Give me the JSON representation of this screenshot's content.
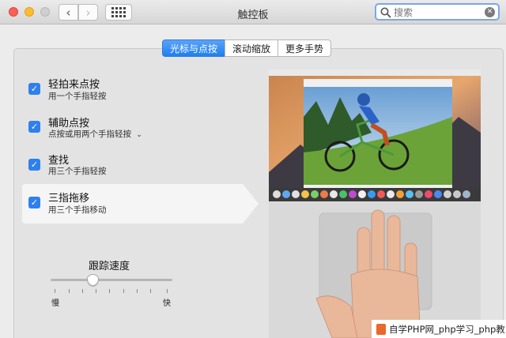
{
  "window": {
    "title": "触控板"
  },
  "search": {
    "placeholder": "搜索",
    "value": ""
  },
  "tabs": [
    {
      "label": "光标与点按",
      "active": true
    },
    {
      "label": "滚动缩放",
      "active": false
    },
    {
      "label": "更多手势",
      "active": false
    }
  ],
  "options": [
    {
      "title": "轻拍来点按",
      "subtitle": "用一个手指轻按",
      "checked": true
    },
    {
      "title": "辅助点按",
      "subtitle": "点按或用两个手指轻按",
      "checked": true,
      "has_dropdown": true
    },
    {
      "title": "查找",
      "subtitle": "用三个手指轻按",
      "checked": true
    },
    {
      "title": "三指拖移",
      "subtitle": "用三个手指移动",
      "checked": true,
      "selected": true
    }
  ],
  "tracking_speed": {
    "label": "跟踪速度",
    "min_label": "慢",
    "max_label": "快",
    "value_fraction": 0.35
  },
  "watermark": {
    "text": "自学PHP网_php学习_php教"
  },
  "colors": {
    "accent": "#1f7ff0",
    "checkbox": "#2f80ed",
    "highlight": "#f5f5f5"
  }
}
